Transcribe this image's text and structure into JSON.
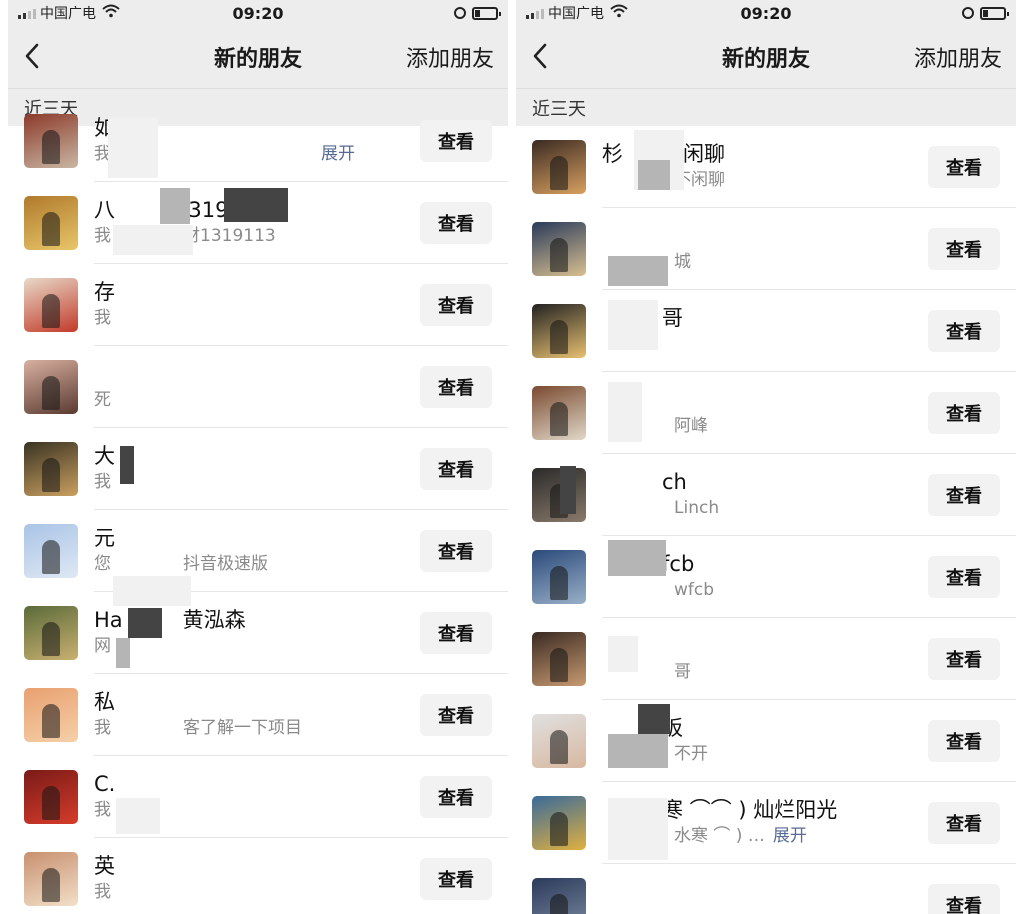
{
  "status": {
    "carrier": "中国广电",
    "time": "09:20"
  },
  "colors": {
    "bar_bg": "#ededed",
    "button_bg": "#f2f2f2",
    "link": "#576b95",
    "sub_text": "#8a8a8a"
  },
  "icons": {
    "back": "chevron-left-icon",
    "wifi": "wifi-icon",
    "lock": "rotation-lock-icon",
    "battery": "battery-icon"
  },
  "left": {
    "title": "新的朋友",
    "action": "添加朋友",
    "section": "近三天",
    "rows": [
      {
        "name": "如",
        "message": "我",
        "expand": "展开",
        "button": "查看",
        "colors": [
          "#8c3a2a",
          "#c9b7a4"
        ]
      },
      {
        "name": "八",
        "name_tail": "1319113",
        "message": "我",
        "message_tail": "财1319113",
        "button": "查看",
        "colors": [
          "#b07a2c",
          "#e8c66a"
        ]
      },
      {
        "name": "存",
        "message": "我",
        "button": "查看",
        "colors": [
          "#e8d9c8",
          "#c23a2a"
        ]
      },
      {
        "name": "",
        "message": "死",
        "button": "查看",
        "colors": [
          "#d8b0a0",
          "#5a3a30"
        ]
      },
      {
        "name": "大",
        "message": "我",
        "button": "查看",
        "colors": [
          "#3a3322",
          "#c9a060"
        ]
      },
      {
        "name": "元",
        "message": "您",
        "message_tail": "抖音极速版",
        "button": "查看",
        "colors": [
          "#a9c4e6",
          "#dfe8f4"
        ]
      },
      {
        "name": "Ha",
        "name_tail": "黄泓森",
        "message": "网",
        "button": "查看",
        "colors": [
          "#5b6b3a",
          "#c9b070"
        ]
      },
      {
        "name": "私",
        "message": "我",
        "message_tail": "客了解一下项目",
        "button": "查看",
        "colors": [
          "#e8a070",
          "#f6d0a8"
        ]
      },
      {
        "name": "C.",
        "message": "我",
        "button": "查看",
        "colors": [
          "#7a1a18",
          "#d63c2a"
        ]
      },
      {
        "name": "英",
        "message": "我",
        "button": "查看",
        "colors": [
          "#c89070",
          "#f2e0c8"
        ]
      }
    ]
  },
  "right": {
    "title": "新的朋友",
    "action": "添加朋友",
    "section": "近三天",
    "rows": [
      {
        "name": "杉",
        "name_tail": "闲聊",
        "message": "",
        "message_tail": "不闲聊",
        "button": "查看",
        "colors": [
          "#3a2a22",
          "#d8a060"
        ]
      },
      {
        "name": "",
        "message": "",
        "message_tail": "城",
        "button": "查看",
        "colors": [
          "#2a3a5a",
          "#d8c090"
        ]
      },
      {
        "name": "",
        "name_tail": "哥",
        "message": "",
        "button": "查看",
        "colors": [
          "#222222",
          "#e8c070"
        ]
      },
      {
        "name": "",
        "message": "",
        "message_tail": "阿峰",
        "button": "查看",
        "colors": [
          "#7a4a30",
          "#e0d8c8"
        ]
      },
      {
        "name": "",
        "name_tail": "ch",
        "message": "",
        "message_tail": "Linch",
        "button": "查看",
        "colors": [
          "#2a2a2a",
          "#8a7a6a"
        ]
      },
      {
        "name": "",
        "name_tail": "fcb",
        "message": "",
        "message_tail": "wfcb",
        "button": "查看",
        "colors": [
          "#2a4a7a",
          "#9ab0c8"
        ]
      },
      {
        "name": "",
        "message": "",
        "message_tail": "哥",
        "button": "查看",
        "colors": [
          "#3a2a22",
          "#c89a70"
        ]
      },
      {
        "name": "",
        "name_tail": "板",
        "message": "",
        "message_tail": "不开",
        "button": "查看",
        "colors": [
          "#e0e0e0",
          "#d8b8a0"
        ]
      },
      {
        "name": "",
        "name_tail": "寒 ⌒⌒ ) 灿烂阳光",
        "message": "",
        "message_tail": "水寒 ⌒ ) …",
        "expand": "展开",
        "button": "查看",
        "colors": [
          "#3a6a9a",
          "#e0b040"
        ]
      },
      {
        "name": "",
        "message": "",
        "button": "查看",
        "colors": [
          "#2a3a5a",
          "#7a8aa0"
        ]
      }
    ]
  }
}
